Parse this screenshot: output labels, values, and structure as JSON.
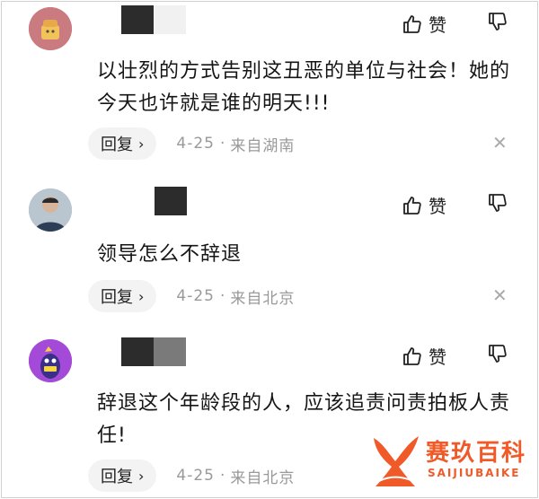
{
  "comments": [
    {
      "text": "以壮烈的方式告别这丑恶的单位与社会！她的今天也许就是谁的明天!!!",
      "like_label": "赞",
      "reply_label": "回复",
      "date": "4-25",
      "location": "来自湖南"
    },
    {
      "text": "领导怎么不辞退",
      "like_label": "赞",
      "reply_label": "回复",
      "date": "4-25",
      "location": "来自北京"
    },
    {
      "text": "辞退这个年龄段的人，应该追责问责拍板人责任!",
      "like_label": "赞",
      "reply_label": "回复",
      "date": "4-25",
      "location": "来自北京"
    }
  ],
  "watermark": {
    "title": "赛玖百科",
    "subtitle": "SAIJIUBAIKE",
    "color": "#f05a28"
  }
}
